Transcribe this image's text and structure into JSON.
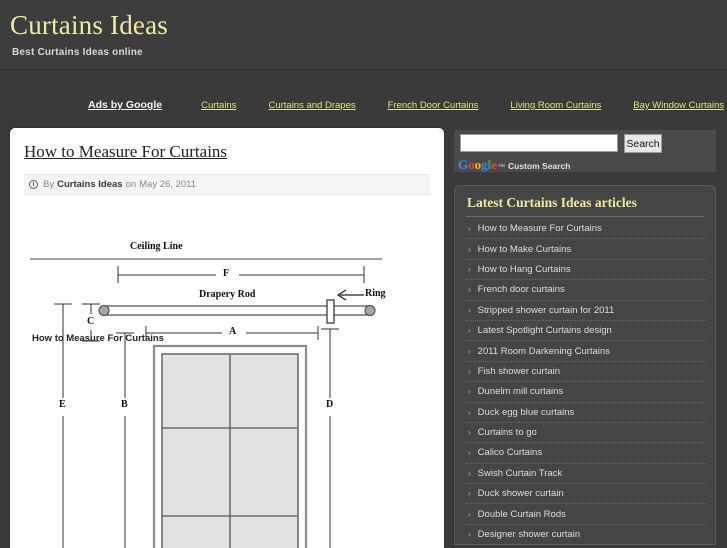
{
  "header": {
    "title": "Curtains Ideas",
    "tagline": "Best Curtains Ideas online",
    "title_color": "#f2e9a0"
  },
  "ads_nav": {
    "label": "Ads by Google",
    "links": [
      "Curtains",
      "Curtains and Drapes",
      "French Door Curtains",
      "Living Room Curtains",
      "Bay Window Curtains"
    ],
    "link_color": "#ece08a"
  },
  "post": {
    "title": "How to Measure For Curtains",
    "byline_prefix": "By",
    "author": "Curtains Ideas",
    "byline_mid": "on",
    "date": "May 26, 2011",
    "subheading": "How to Measure For Curtains"
  },
  "diagram": {
    "ceiling_line": "Ceiling Line",
    "drapery_rod": "Drapery Rod",
    "ring": "Ring",
    "markers": {
      "f": "F",
      "a": "A",
      "c": "C",
      "e": "E",
      "b": "B",
      "d": "D"
    }
  },
  "search": {
    "value": "",
    "placeholder": "",
    "button_label": "Search",
    "brand_google": [
      "G",
      "o",
      "o",
      "g",
      "l",
      "e"
    ],
    "brand_colors": [
      "#4285f4",
      "#ea4335",
      "#fbbc05",
      "#4285f4",
      "#34a853",
      "#ea4335"
    ],
    "trademark": "™",
    "brand_label": "Custom Search"
  },
  "sidebar": {
    "widget_title": "Latest Curtains Ideas articles",
    "chevron": "›",
    "articles": [
      "How to Measure For Curtains",
      "How to Make Curtains",
      "How to Hang Curtains",
      "French door curtains",
      "Stripped shower curtain for 2011",
      "Latest Spotlight Curtains design",
      "2011 Room Darkening Curtains",
      "Fish shower curtain",
      "Dunelm mill curtains",
      "Duck egg blue curtains",
      "Curtains to go",
      "Calico Curtains",
      "Swish Curtain Track",
      "Duck shower curtain",
      "Double Curtain Rods",
      "Designer shower curtain"
    ]
  }
}
